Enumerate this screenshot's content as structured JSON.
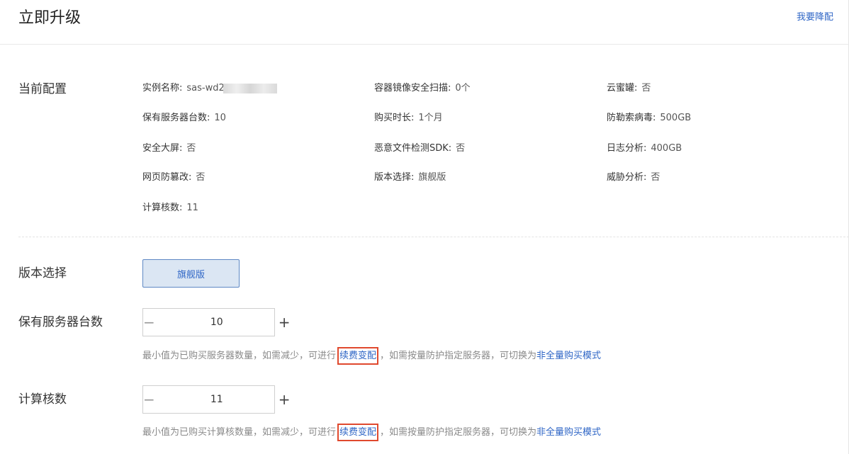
{
  "header": {
    "title": "立即升级",
    "downgrade_link": "我要降配"
  },
  "current_config": {
    "label": "当前配置",
    "items": [
      {
        "key": "实例名称:",
        "value": "sas-wd2"
      },
      {
        "key": "容器镜像安全扫描:",
        "value": "0个"
      },
      {
        "key": "云蜜罐:",
        "value": "否"
      },
      {
        "key": "保有服务器台数:",
        "value": "10"
      },
      {
        "key": "购买时长:",
        "value": "1个月"
      },
      {
        "key": "防勒索病毒:",
        "value": "500GB"
      },
      {
        "key": "安全大屏:",
        "value": "否"
      },
      {
        "key": "恶意文件检测SDK:",
        "value": "否"
      },
      {
        "key": "日志分析:",
        "value": "400GB"
      },
      {
        "key": "网页防篡改:",
        "value": "否"
      },
      {
        "key": "版本选择:",
        "value": "旗舰版"
      },
      {
        "key": "威胁分析:",
        "value": "否"
      },
      {
        "key": "计算核数:",
        "value": "11"
      }
    ]
  },
  "edition": {
    "label": "版本选择",
    "selected": "旗舰版"
  },
  "server_count": {
    "label": "保有服务器台数",
    "minus": "−",
    "plus": "+",
    "value": "10",
    "hint_prefix": "最小值为已购买服务器数量，如需减少，可进行",
    "renew_link": "续费变配",
    "hint_middle": "，如需按量防护指定服务器，可切换为",
    "mode_link": "非全量购买模式"
  },
  "core_count": {
    "label": "计算核数",
    "minus": "−",
    "plus": "+",
    "value": "11",
    "hint_prefix": "最小值为已购买计算核数量，如需减少，可进行",
    "renew_link": "续费变配",
    "hint_middle": "，如需按量防护指定服务器，可切换为",
    "mode_link": "非全量购买模式"
  },
  "colors": {
    "accent": "#2f66c6",
    "highlight_box": "#e0492e",
    "selected_bg": "#dbe6f3"
  }
}
